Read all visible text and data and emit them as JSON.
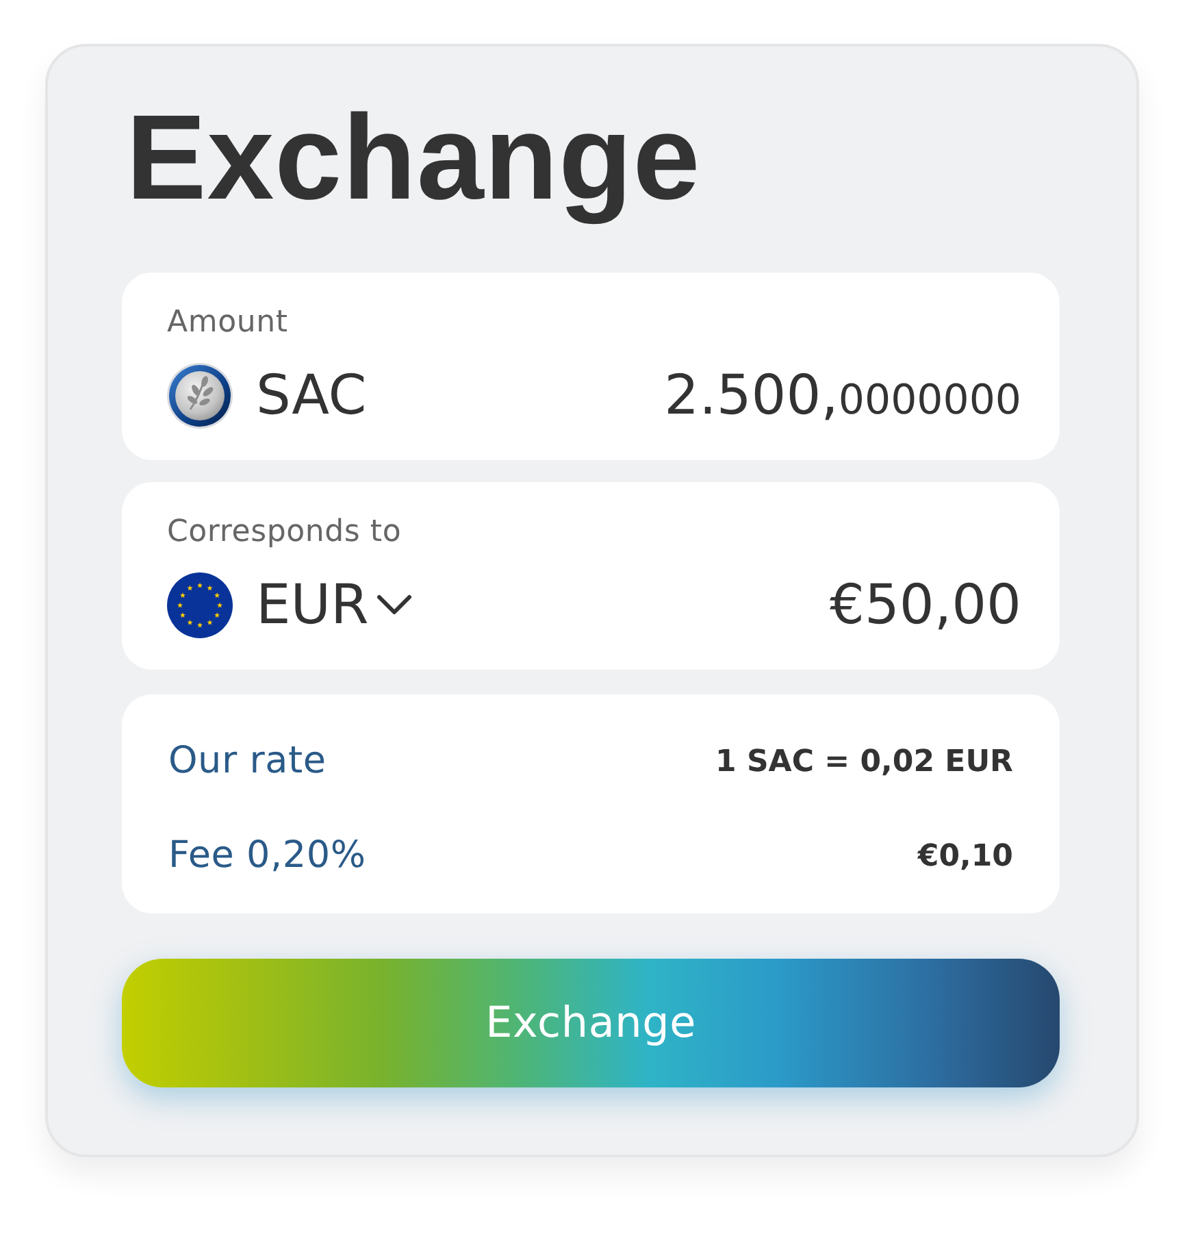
{
  "title": "Exchange",
  "panels": [
    {
      "label": "Amount",
      "currency": "SAC",
      "dropdown": false,
      "value": "2.500,",
      "value_decimals": "0000000"
    },
    {
      "label": "Corresponds to",
      "currency": "EUR",
      "dropdown": true,
      "value": "€50,00"
    }
  ],
  "summary": [
    {
      "label": "Our rate",
      "value": "1 SAC = 0,02 EUR"
    },
    {
      "label": "Fee 0,20%",
      "value": "€0,10"
    }
  ],
  "button": {
    "label": "Exchange"
  }
}
